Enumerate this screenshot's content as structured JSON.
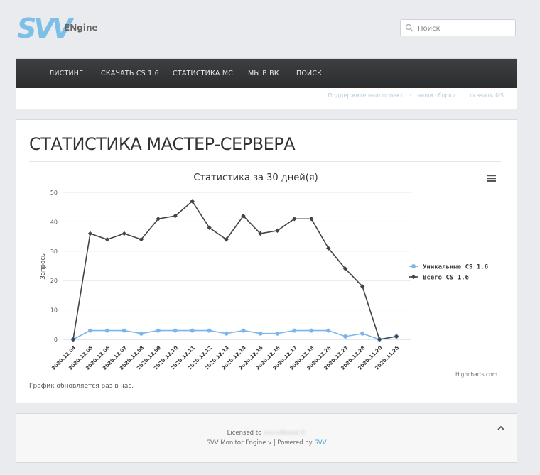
{
  "header": {
    "logo_mark": "SVV",
    "logo_text": "ENgine",
    "search_placeholder": "Поиск"
  },
  "nav": {
    "items": [
      "ЛИСТИНГ",
      "СКАЧАТЬ CS 1.6",
      "СТАТИСТИКА МС",
      "МЫ В ВК",
      "ПОИСК"
    ],
    "sub_links": [
      "Поддержите наш проект",
      "наши сборки",
      "скачать MS"
    ]
  },
  "main": {
    "title": "СТАТИСТИКА МАСТЕР-СЕРВЕРА",
    "note": "График обновляется раз в час."
  },
  "chart_data": {
    "type": "line",
    "title": "Статистика за 30 дней(я)",
    "ylabel": "Запросы",
    "ylim": [
      0,
      50
    ],
    "yticks": [
      0,
      10,
      20,
      30,
      40,
      50
    ],
    "categories": [
      "2020.12.04",
      "2020.12.05",
      "2020.12.06",
      "2020.12.07",
      "2020.12.08",
      "2020.12.09",
      "2020.12.10",
      "2020.12.11",
      "2020.12.12",
      "2020.12.13",
      "2020.12.14",
      "2020.12.15",
      "2020.12.16",
      "2020.12.17",
      "2020.12.18",
      "2020.12.26",
      "2020.12.27",
      "2020.12.28",
      "2020.11.20",
      "2020.11.25"
    ],
    "series": [
      {
        "name": "Уникальные CS 1.6",
        "color": "#7cb5ec",
        "values": [
          0,
          3,
          3,
          3,
          2,
          3,
          3,
          3,
          3,
          2,
          3,
          2,
          2,
          3,
          3,
          3,
          1,
          2,
          0,
          1
        ]
      },
      {
        "name": "Всего CS 1.6",
        "color": "#434348",
        "values": [
          0,
          36,
          34,
          36,
          34,
          41,
          42,
          47,
          38,
          34,
          42,
          36,
          37,
          41,
          41,
          31,
          24,
          18,
          0,
          1
        ]
      }
    ],
    "credits": "Highcharts.com",
    "legend": "right"
  },
  "footer": {
    "licensed": "Licensed to",
    "licensee": "svv.cdboost.fr",
    "powered": "SVV Monitor Engine v | Powered by",
    "powered_link": "SVV"
  }
}
